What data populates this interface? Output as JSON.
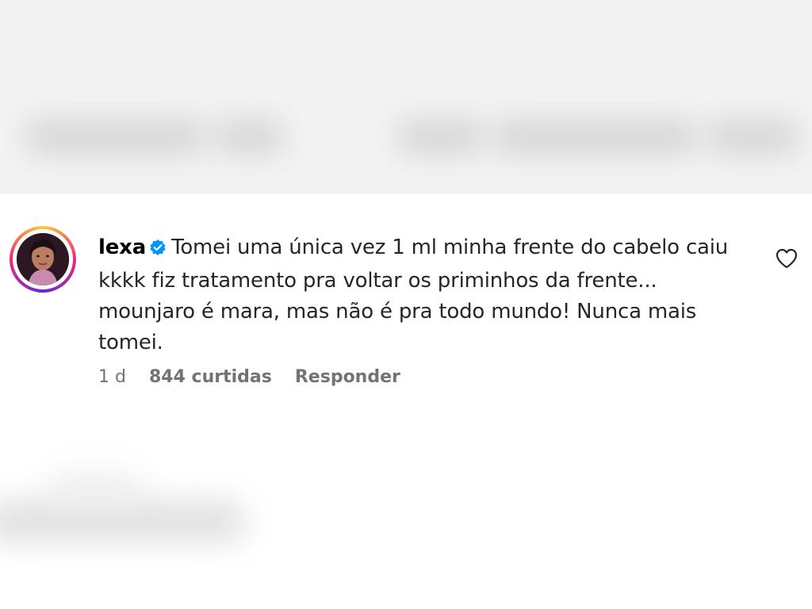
{
  "comment": {
    "username": "lexa",
    "verified": true,
    "text": "Tomei uma única vez 1 ml minha frente do cabelo caiu kkkk fiz tratamento pra voltar os priminhos da frente... mounjaro é mara, mas não é pra todo mundo! Nunca mais tomei.",
    "time": "1 d",
    "likes": "844 curtidas",
    "reply_label": "Responder"
  },
  "icons": {
    "avatar": "user-avatar-icon",
    "verified": "verified-badge-icon",
    "like": "heart-icon"
  },
  "colors": {
    "verified_blue": "#0095f6",
    "text": "#262626",
    "meta": "#737373"
  }
}
